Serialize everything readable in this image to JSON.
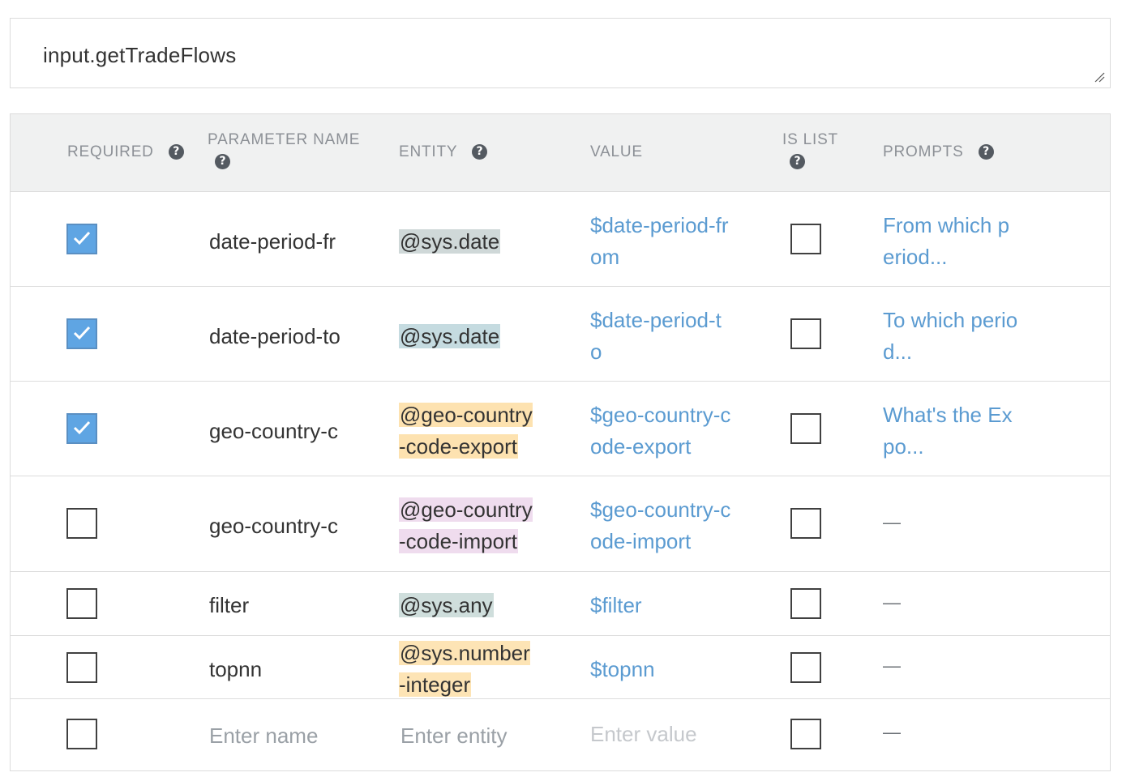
{
  "action": {
    "value": "input.getTradeFlows"
  },
  "table": {
    "headers": {
      "required": "REQUIRED",
      "parameter_name": "PARAMETER NAME",
      "entity": "ENTITY",
      "value": "VALUE",
      "is_list": "IS LIST",
      "prompts": "PROMPTS"
    },
    "help_glyph": "?",
    "rows": [
      {
        "required": true,
        "name": "date-period-fr",
        "entity": "@sys.date",
        "entity_color": "#cfd8d8",
        "value": "$date-period-from",
        "is_list": false,
        "prompt": "From which period..."
      },
      {
        "required": true,
        "name": "date-period-to",
        "entity": "@sys.date",
        "entity_color": "#c5dbe0",
        "value": "$date-period-to",
        "is_list": false,
        "prompt": "To which period..."
      },
      {
        "required": true,
        "name": "geo-country-c",
        "entity": "@geo-country-code-export",
        "entity_color": "#fde2b0",
        "value": "$geo-country-code-export",
        "is_list": false,
        "prompt": "What's the Expo..."
      },
      {
        "required": false,
        "name": "geo-country-c",
        "entity": "@geo-country-code-import",
        "entity_color": "#efdcee",
        "value": "$geo-country-code-import",
        "is_list": false,
        "prompt": "—"
      },
      {
        "required": false,
        "name": "filter",
        "entity": "@sys.any",
        "entity_color": "#cfdedc",
        "value": "$filter",
        "is_list": false,
        "prompt": "—"
      },
      {
        "required": false,
        "name": "topnn",
        "entity": "@sys.number-integer",
        "entity_color": "#fde4b5",
        "value": "$topnn",
        "is_list": false,
        "prompt": "—"
      }
    ],
    "new_row": {
      "name_placeholder": "Enter name",
      "entity_placeholder": "Enter entity",
      "value_placeholder": "Enter value",
      "prompt": "—",
      "required": false,
      "is_list": false
    }
  },
  "colors": {
    "checkbox_checked": "#5fa5e3",
    "link_blue": "#5b9bd1",
    "header_bg": "#f0f1f1"
  },
  "icons": {
    "help": "help-circle-icon",
    "check": "check-icon",
    "resize": "resize-handle-icon"
  }
}
